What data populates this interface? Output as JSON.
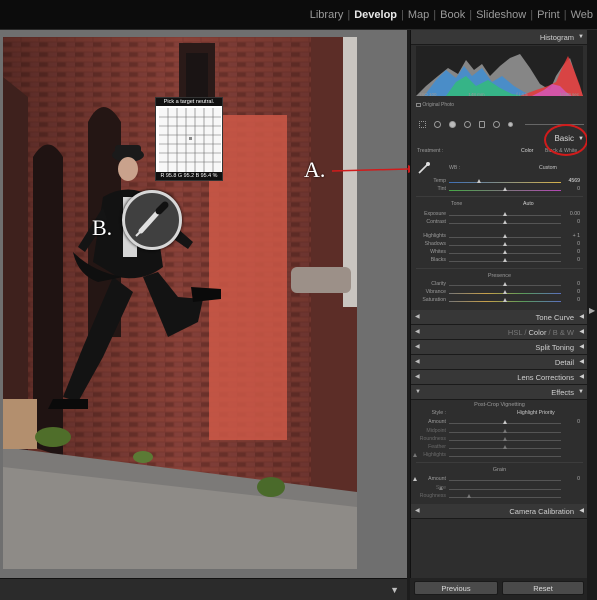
{
  "modules": [
    "Library",
    "Develop",
    "Map",
    "Book",
    "Slideshow",
    "Print",
    "Web"
  ],
  "active_module": "Develop",
  "annotations": {
    "a": "A.",
    "b": "B."
  },
  "loupe": {
    "title": "Pick a target neutral.",
    "readout": "R 95.8  G 95.2  B 95.4 %"
  },
  "histogram": {
    "title": "Histogram",
    "iso": "ISO 100",
    "focal": "148 mm",
    "aperture": "f / 4.5",
    "shutter": "1/250 sec",
    "original_photo": "Original Photo"
  },
  "basic": {
    "title": "Basic",
    "treatment_label": "Treatment :",
    "treatment_color": "Color",
    "treatment_bw": "Black & White",
    "wb_label": "WB :",
    "wb_value": "Custom",
    "temp_label": "Temp",
    "temp_value": "4569",
    "tint_label": "Tint",
    "tint_value": "0",
    "tone_label": "Tone",
    "auto_label": "Auto",
    "exposure_label": "Exposure",
    "exposure_value": "0.00",
    "contrast_label": "Contrast",
    "contrast_value": "0",
    "highlights_label": "Highlights",
    "highlights_value": "+ 1",
    "shadows_label": "Shadows",
    "shadows_value": "0",
    "whites_label": "Whites",
    "whites_value": "0",
    "blacks_label": "Blacks",
    "blacks_value": "0",
    "presence_label": "Presence",
    "clarity_label": "Clarity",
    "clarity_value": "0",
    "vibrance_label": "Vibrance",
    "vibrance_value": "0",
    "saturation_label": "Saturation",
    "saturation_value": "0"
  },
  "panels": {
    "tone_curve": "Tone Curve",
    "hsl": "HSL",
    "hsl_color": "Color",
    "hsl_bw": "B & W",
    "split_toning": "Split Toning",
    "detail": "Detail",
    "lens_corrections": "Lens Corrections",
    "effects": "Effects",
    "camera_calibration": "Camera Calibration"
  },
  "effects": {
    "vignetting_label": "Post-Crop Vignetting",
    "style_label": "Style :",
    "style_value": "Highlight Priority",
    "amount_label": "Amount",
    "amount_value": "0",
    "midpoint_label": "Midpoint",
    "roundness_label": "Roundness",
    "feather_label": "Feather",
    "highlights_label": "Highlights",
    "grain_label": "Grain",
    "grain_amount_label": "Amount",
    "grain_amount_value": "0",
    "size_label": "Size",
    "roughness_label": "Roughness"
  },
  "buttons": {
    "previous": "Previous",
    "reset": "Reset"
  },
  "colors": {
    "annotation_red": "#d11b1b",
    "panel_bg": "#2e2e2e",
    "topbar_bg": "#0c0c0c"
  }
}
